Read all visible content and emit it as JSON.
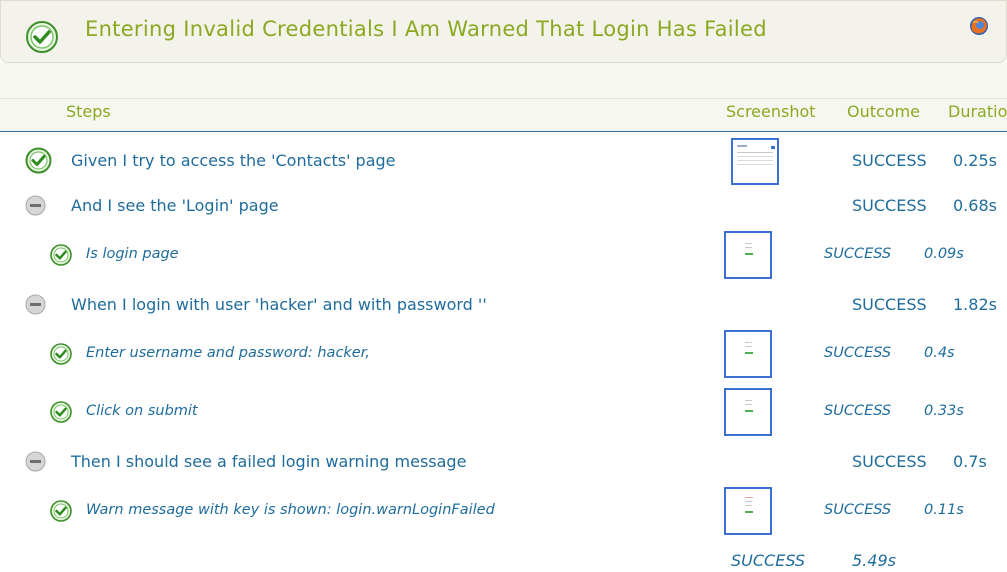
{
  "title": "Entering Invalid Credentials I Am Warned That Login Has Failed",
  "headers": {
    "steps": "Steps",
    "screenshot": "Screenshot",
    "outcome": "Outcome",
    "duration": "Duratio"
  },
  "steps": [
    {
      "text": "Given I try to access the 'Contacts' page",
      "outcome": "SUCCESS",
      "duration": "0.25s",
      "icon": "success-check-icon",
      "screenshot": true
    },
    {
      "text": "And I see the 'Login' page",
      "outcome": "SUCCESS",
      "duration": "0.68s",
      "icon": "collapse-minus-icon",
      "screenshot": false
    },
    {
      "text": "Is login page",
      "outcome": "SUCCESS",
      "duration": "0.09s",
      "icon": "success-check-icon",
      "screenshot": true
    },
    {
      "text": "When I login with user 'hacker' and with password ''",
      "outcome": "SUCCESS",
      "duration": "1.82s",
      "icon": "collapse-minus-icon",
      "screenshot": false
    },
    {
      "text": "Enter username and password: hacker,",
      "outcome": "SUCCESS",
      "duration": "0.4s",
      "icon": "success-check-icon",
      "screenshot": true
    },
    {
      "text": "Click on submit",
      "outcome": "SUCCESS",
      "duration": "0.33s",
      "icon": "success-check-icon",
      "screenshot": true
    },
    {
      "text": "Then I should see a failed login warning message",
      "outcome": "SUCCESS",
      "duration": "0.7s",
      "icon": "collapse-minus-icon",
      "screenshot": false
    },
    {
      "text": "Warn message with key is shown: login.warnLoginFailed",
      "outcome": "SUCCESS",
      "duration": "0.11s",
      "icon": "success-check-icon",
      "screenshot": true
    }
  ],
  "total": {
    "outcome": "SUCCESS",
    "duration": "5.49s"
  },
  "colors": {
    "title": "#8aa920",
    "step_text": "#1f6c9c",
    "header_rule": "#2f6f99",
    "thumb_border": "#3b6fd0"
  }
}
